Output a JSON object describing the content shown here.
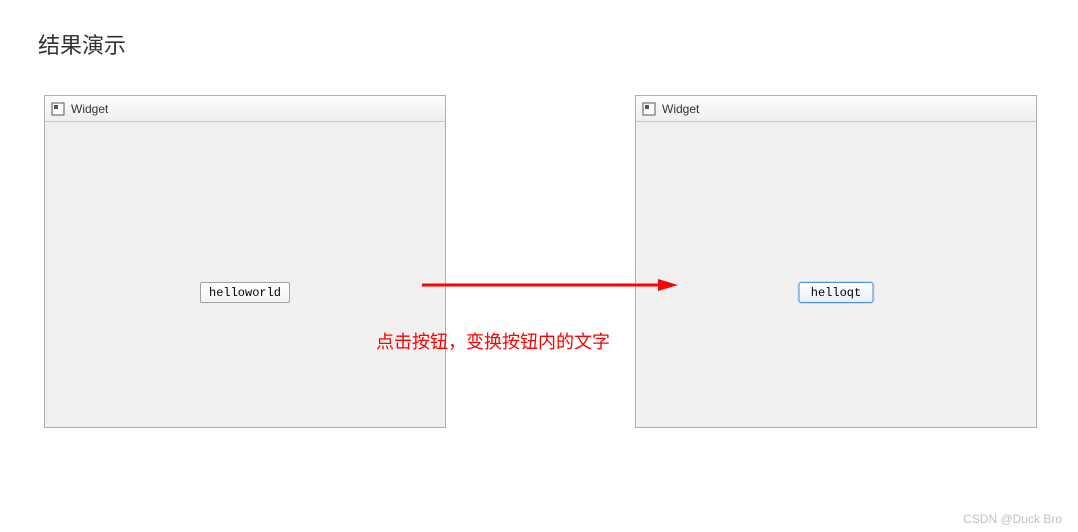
{
  "page_title": "结果演示",
  "window_left": {
    "title": "Widget",
    "button_label": "helloworld"
  },
  "window_right": {
    "title": "Widget",
    "button_label": "helloqt"
  },
  "annotation": {
    "caption": "点击按钮，变换按钮内的文字"
  },
  "watermark": "CSDN @Duck Bro"
}
